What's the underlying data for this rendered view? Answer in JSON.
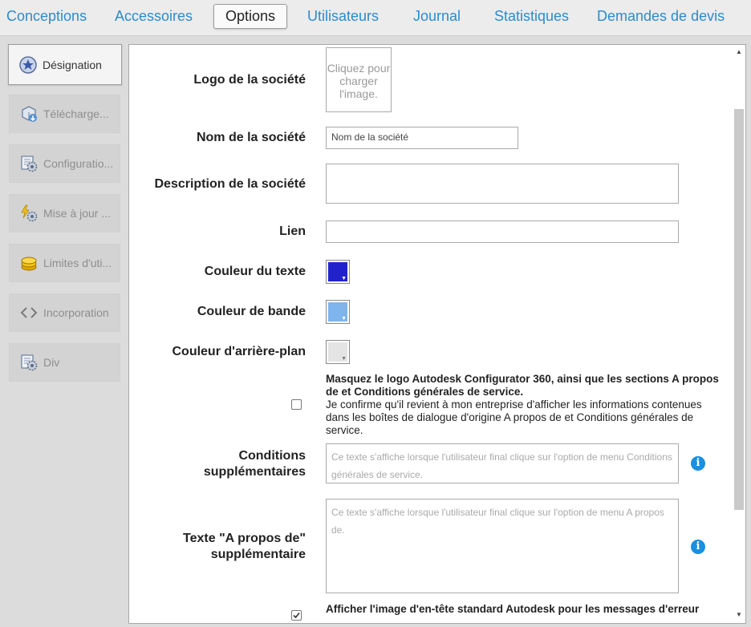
{
  "tabs": [
    {
      "label": "Conceptions"
    },
    {
      "label": "Accessoires"
    },
    {
      "label": "Options"
    },
    {
      "label": "Utilisateurs"
    },
    {
      "label": "Journal"
    },
    {
      "label": "Statistiques"
    },
    {
      "label": "Demandes de devis"
    }
  ],
  "sidebar": {
    "items": [
      {
        "label": "Désignation",
        "icon": "star-badge-icon"
      },
      {
        "label": "Télécharge...",
        "icon": "upload-cube-icon"
      },
      {
        "label": "Configuratio...",
        "icon": "config-gear-icon"
      },
      {
        "label": "Mise à jour ...",
        "icon": "lightning-gear-icon"
      },
      {
        "label": "Limites d'uti...",
        "icon": "coins-icon"
      },
      {
        "label": "Incorporation",
        "icon": "code-brackets-icon"
      },
      {
        "label": "Div",
        "icon": "div-gear-icon"
      }
    ]
  },
  "form": {
    "logo": {
      "label": "Logo de la société",
      "upload_text": "Cliquez pour charger l'image."
    },
    "company_name": {
      "label": "Nom de la société",
      "value": "Nom de la société"
    },
    "company_description": {
      "label": "Description de la société",
      "value": ""
    },
    "link": {
      "label": "Lien",
      "value": ""
    },
    "text_color": {
      "label": "Couleur du texte",
      "color": "#2222cc"
    },
    "band_color": {
      "label": "Couleur de bande",
      "color": "#7fb4ec"
    },
    "background_color": {
      "label": "Couleur d'arrière-plan",
      "color": "#e4e4e4"
    },
    "hide_logo": {
      "checked": false,
      "title": "Masquez le logo Autodesk Configurator 360, ainsi que les sections A propos de et Conditions générales de service.",
      "description": "Je confirme qu'il revient à mon entreprise d'afficher les informations contenues dans les boîtes de dialogue d'origine A propos de et Conditions générales de service."
    },
    "additional_terms": {
      "label": "Conditions supplémentaires",
      "placeholder": "Ce texte s'affiche lorsque l'utilisateur final clique sur l'option de menu Conditions générales de service."
    },
    "additional_about": {
      "label": "Texte \"A propos de\" supplémentaire",
      "placeholder": "Ce texte s'affiche lorsque l'utilisateur final clique sur l'option de menu A propos de."
    },
    "show_header_image": {
      "checked": true,
      "title": "Afficher l'image d'en-tête standard Autodesk pour les messages d'erreur"
    }
  }
}
